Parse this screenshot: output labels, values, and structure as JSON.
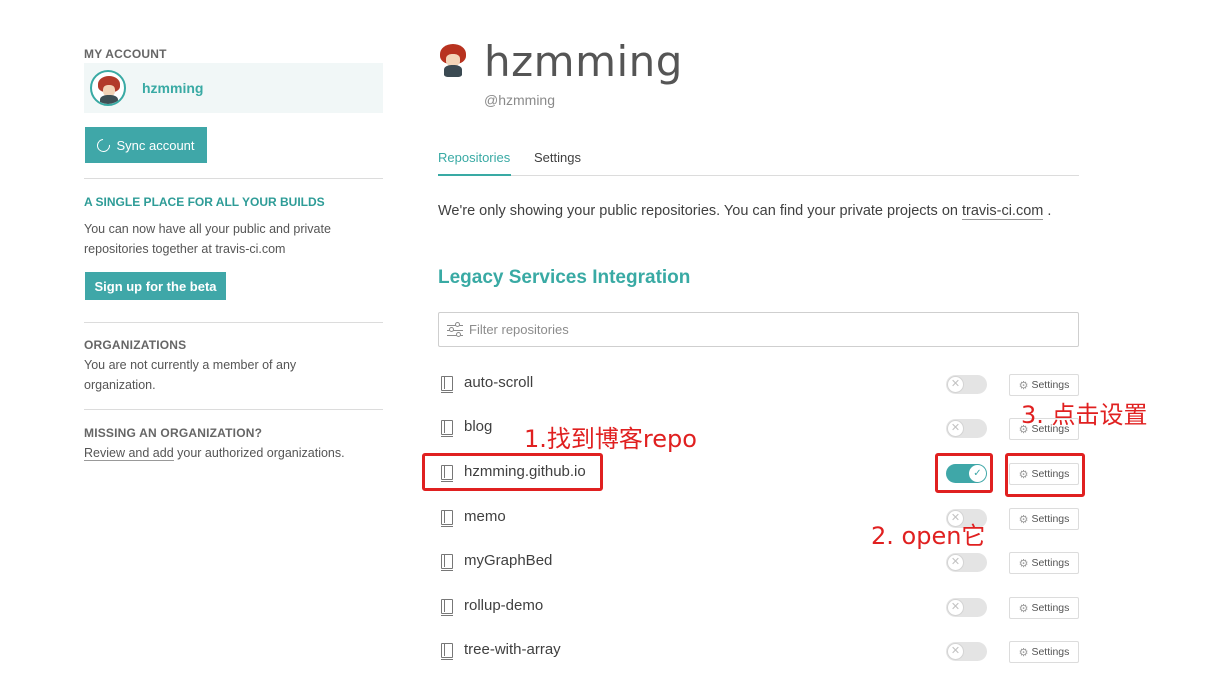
{
  "sidebar": {
    "my_account_title": "MY ACCOUNT",
    "account_name": "hzmming",
    "sync_label": "Sync account",
    "beta_title": "A SINGLE PLACE FOR ALL YOUR BUILDS",
    "beta_text": "You can now have all your public and private repositories together at travis-ci.com",
    "beta_button": "Sign up for the beta",
    "orgs_title": "ORGANIZATIONS",
    "orgs_text": "You are not currently a member of any organization.",
    "missing_title": "MISSING AN ORGANIZATION?",
    "missing_link": "Review and add",
    "missing_rest": " your authorized organizations."
  },
  "profile": {
    "name": "hzmming",
    "handle": "@hzmming"
  },
  "tabs": {
    "repositories": "Repositories",
    "settings": "Settings"
  },
  "notice": {
    "text": "We're only showing your public repositories. You can find your private projects on ",
    "link": "travis-ci.com",
    "end": " ."
  },
  "legacy_title": "Legacy Services Integration",
  "filter": {
    "placeholder": "Filter repositories"
  },
  "repos": [
    {
      "name": "auto-scroll",
      "active": false,
      "settings_label": "Settings"
    },
    {
      "name": "blog",
      "active": false,
      "settings_label": "Settings"
    },
    {
      "name": "hzmming.github.io",
      "active": true,
      "settings_label": "Settings"
    },
    {
      "name": "memo",
      "active": false,
      "settings_label": "Settings"
    },
    {
      "name": "myGraphBed",
      "active": false,
      "settings_label": "Settings"
    },
    {
      "name": "rollup-demo",
      "active": false,
      "settings_label": "Settings"
    },
    {
      "name": "tree-with-array",
      "active": false,
      "settings_label": "Settings"
    }
  ],
  "annotations": {
    "step1": "1.找到博客repo",
    "step2": "2. open它",
    "step3": "3. 点击设置",
    "color": "#e02020"
  },
  "colors": {
    "accent": "#39aaa4",
    "button": "#3fa7a8"
  }
}
